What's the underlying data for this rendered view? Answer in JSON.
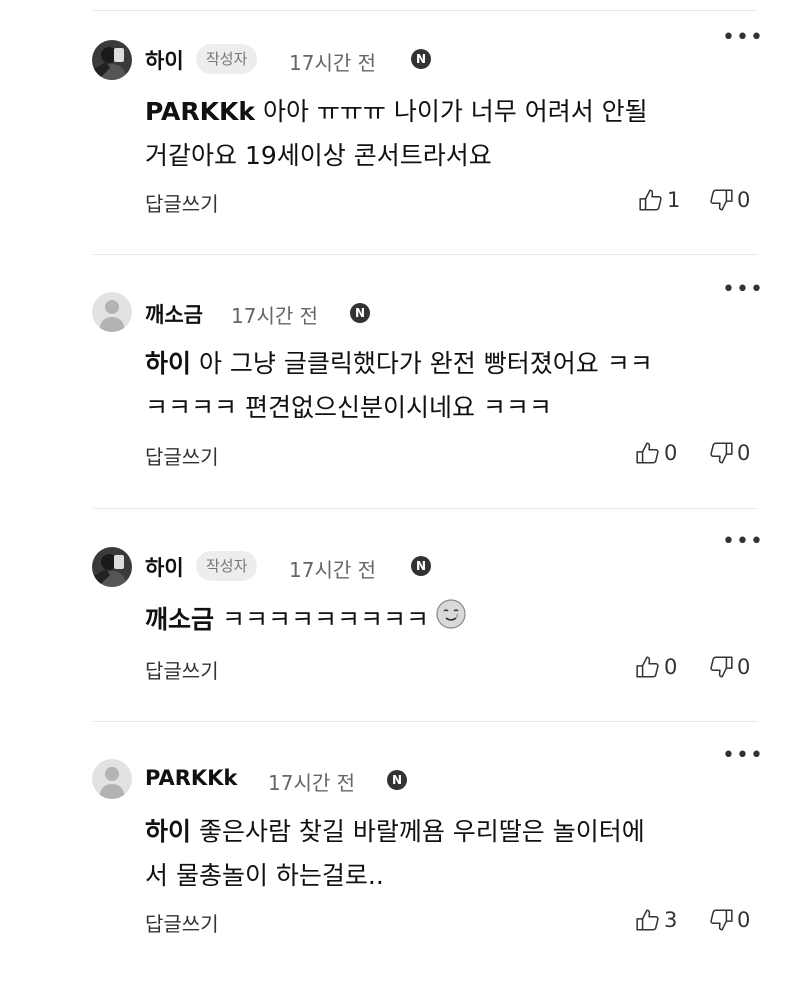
{
  "comments": [
    {
      "author": "하이",
      "author_badge": "작성자",
      "time": "17시간 전",
      "new_badge": "N",
      "mention": "PARKKk",
      "text_line1": " 아아 ㅠㅠㅠ 나이가 너무 어려서 안될",
      "text_line2": "거같아요 19세이상 콘서트라서요",
      "reply_label": "답글쓰기",
      "likes": "1",
      "dislikes": "0",
      "avatar": "profile-photo"
    },
    {
      "author": "깨소금",
      "time": "17시간 전",
      "new_badge": "N",
      "mention": "하이",
      "text_line1": " 아 그냥 글클릭했다가 완전 빵터졌어요 ㅋㅋ",
      "text_line2": "ㅋㅋㅋㅋ 편견없으신분이시네요 ㅋㅋㅋ",
      "reply_label": "답글쓰기",
      "likes": "0",
      "dislikes": "0",
      "avatar": "default-avatar"
    },
    {
      "author": "하이",
      "author_badge": "작성자",
      "time": "17시간 전",
      "new_badge": "N",
      "mention": "깨소금",
      "text_line1": " ㅋㅋㅋㅋㅋㅋㅋㅋㅋ",
      "emoji": "smiling-face-with-tear-emoji",
      "reply_label": "답글쓰기",
      "likes": "0",
      "dislikes": "0",
      "avatar": "profile-photo"
    },
    {
      "author": "PARKKk",
      "time": "17시간 전",
      "new_badge": "N",
      "mention": "하이",
      "text_line1": " 좋은사람 찾길 바랄께욤 우리딸은 놀이터에",
      "text_line2": "서 물총놀이 하는걸로..",
      "reply_label": "답글쓰기",
      "likes": "3",
      "dislikes": "0",
      "avatar": "default-avatar"
    }
  ],
  "more_icon": "•••"
}
